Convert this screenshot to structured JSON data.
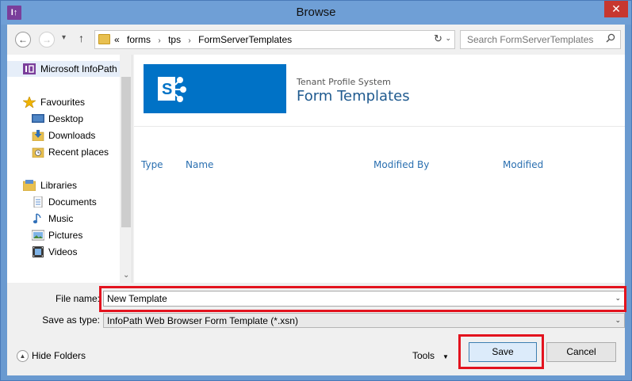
{
  "window": {
    "title": "Browse",
    "app_icon": "I↑",
    "close_glyph": "✕"
  },
  "nav": {
    "back_glyph": "←",
    "forward_glyph": "→",
    "recent_glyph": "▾",
    "up_glyph": "↑",
    "breadcrumbs": [
      "«",
      "forms",
      "tps",
      "FormServerTemplates"
    ],
    "crumb_sep": "›",
    "dropdown_glyph": "⌄",
    "refresh_glyph": "↻",
    "search_placeholder": "Search FormServerTemplates"
  },
  "sidebar": {
    "top_item": "Microsoft InfoPath",
    "favourites": "Favourites",
    "fav_items": [
      "Desktop",
      "Downloads",
      "Recent places"
    ],
    "libraries": "Libraries",
    "lib_items": [
      "Documents",
      "Music",
      "Pictures",
      "Videos"
    ],
    "scroll_down_glyph": "⌄"
  },
  "content": {
    "site_subtitle": "Tenant Profile System",
    "site_title": "Form Templates",
    "columns": [
      "Type",
      "Name",
      "Modified By",
      "Modified"
    ]
  },
  "file": {
    "name_label": "File name:",
    "name_value": "New Template",
    "type_label": "Save as type:",
    "type_value": "InfoPath Web Browser Form Template (*.xsn)",
    "dropdown_glyph": "⌄"
  },
  "footer": {
    "hide_folders_glyph": "▲",
    "hide_folders": "Hide Folders",
    "tools": "Tools",
    "tools_glyph": "▼",
    "save": "Save",
    "cancel": "Cancel"
  },
  "colors": {
    "title_bar": "#6f9fd6",
    "close": "#c7372f",
    "sharepoint": "#0072c6",
    "highlight": "#e3131e",
    "column_header": "#2a6fb0"
  }
}
